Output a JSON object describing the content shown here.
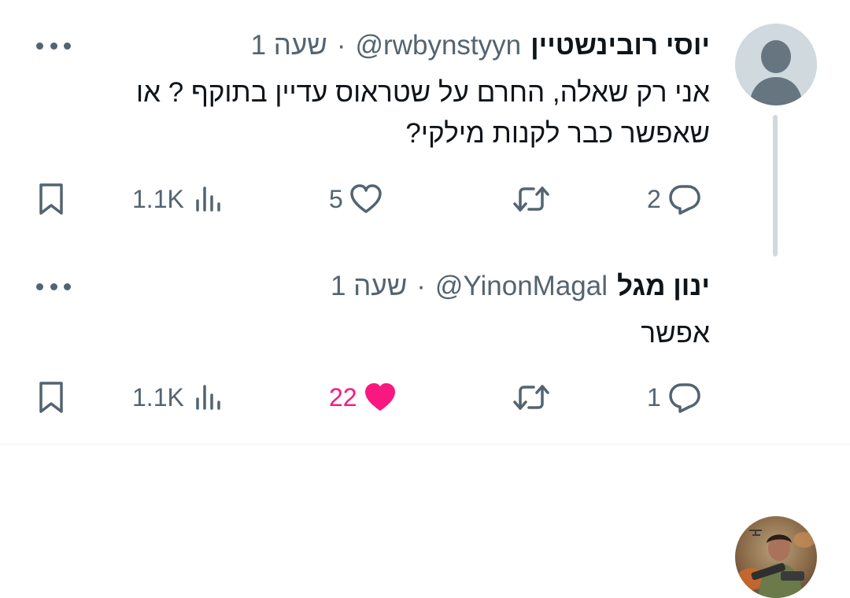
{
  "colors": {
    "text": "#0f1419",
    "secondary": "#536471",
    "like_active": "#f91880",
    "thread_line": "#cfd9de"
  },
  "tweets": [
    {
      "author_name": "יוסי רובינשטיין",
      "handle": "@rwbynstyyn",
      "separator": "·",
      "time": "שעה 1",
      "text": "אני רק שאלה, החרם על שטראוס עדיין בתוקף ? או שאפשר כבר לקנות מילקי?",
      "avatar_icon": "default-profile-icon",
      "reply_count": "2",
      "like_count": "5",
      "views_count": "1.1K",
      "liked": false
    },
    {
      "author_name": "ינון מגל",
      "handle": "@YinonMagal",
      "separator": "·",
      "time": "שעה 1",
      "text": "אפשר",
      "avatar_icon": "profile-photo",
      "reply_count": "1",
      "like_count": "22",
      "views_count": "1.1K",
      "liked": true
    }
  ]
}
